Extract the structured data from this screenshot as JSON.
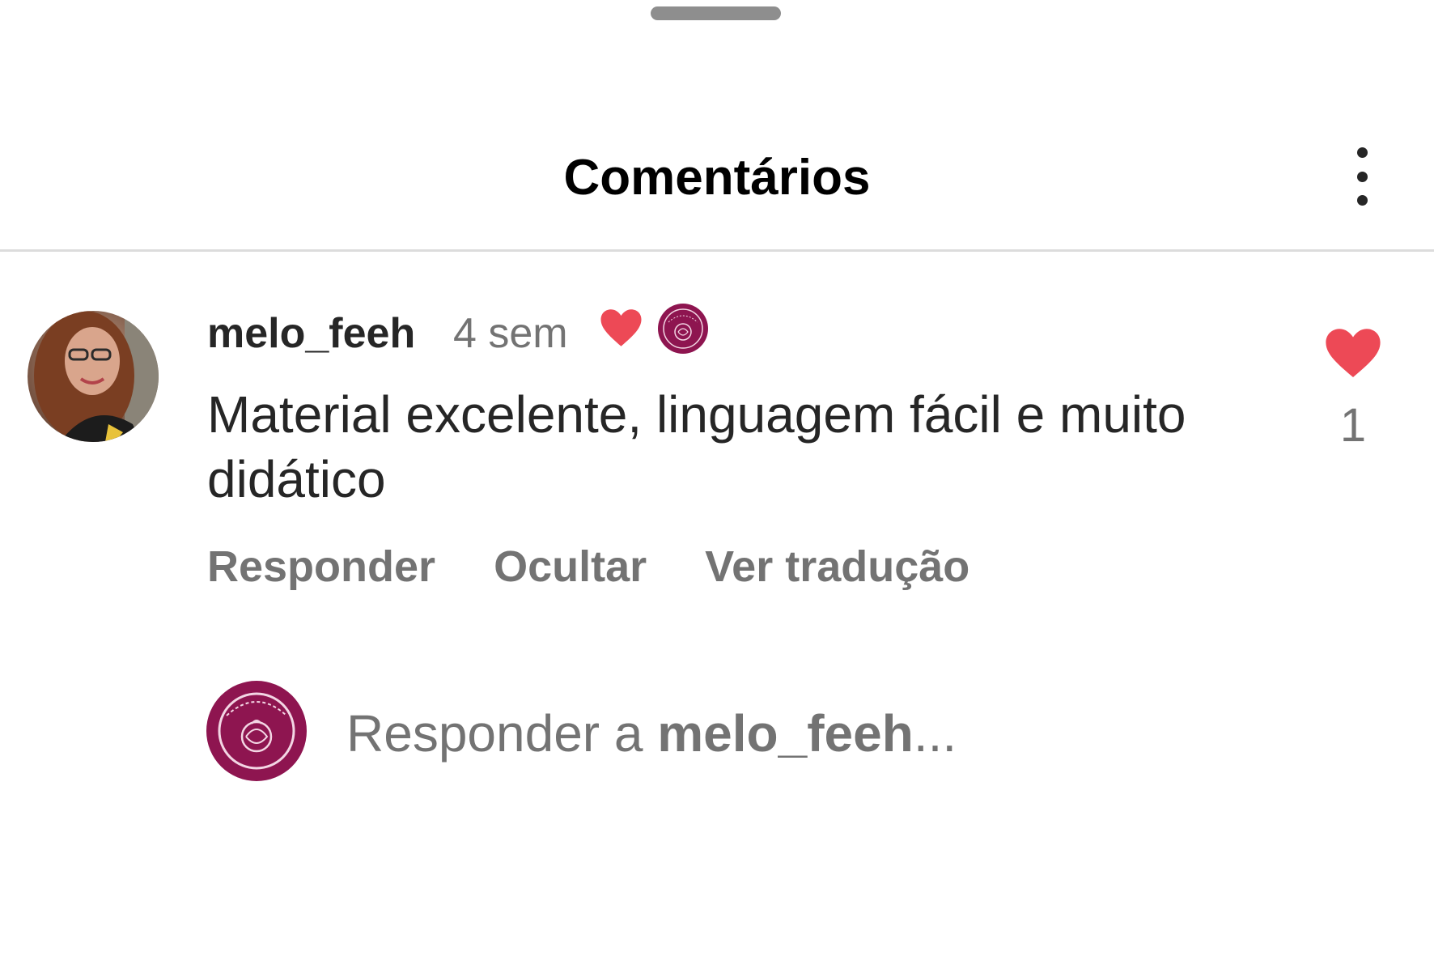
{
  "header": {
    "title": "Comentários"
  },
  "comment": {
    "username": "melo_feeh",
    "time": "4 sem",
    "text": "Material excelente, linguagem fácil e muito didático",
    "actions": {
      "reply": "Responder",
      "hide": "Ocultar",
      "translate": "Ver tradução"
    },
    "like_count": "1"
  },
  "reply_box": {
    "prefix": "Responder a ",
    "username": "melo_feeh",
    "suffix": "..."
  },
  "colors": {
    "heart": "#ed4956",
    "brand": "#8e1550",
    "muted": "#737373"
  },
  "icons": {
    "menu": "more-vertical-icon",
    "like": "heart-icon",
    "creator_liked": "heart-icon"
  }
}
